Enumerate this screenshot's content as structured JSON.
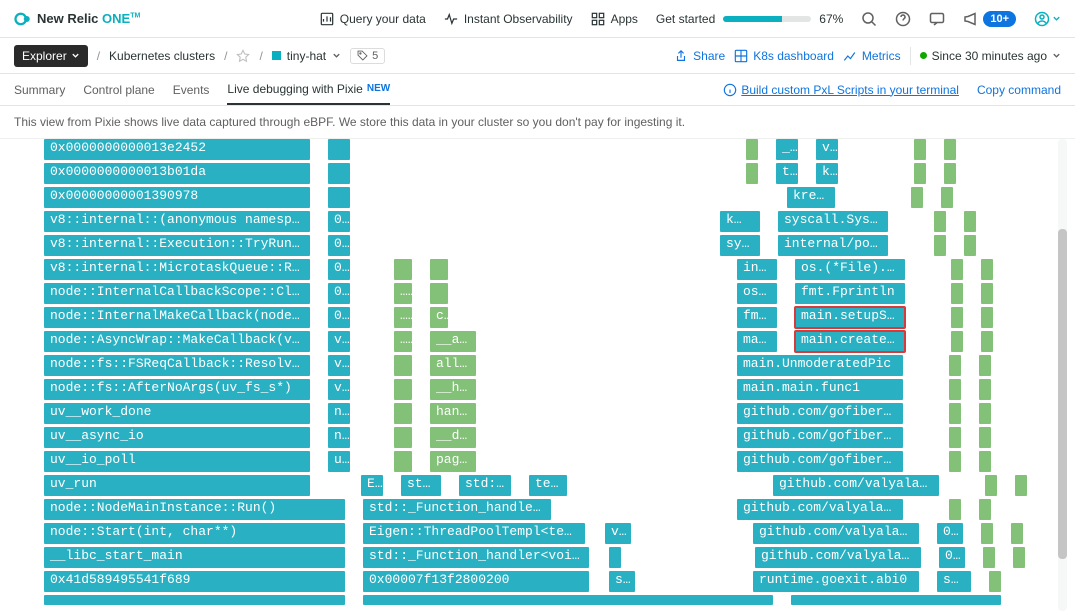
{
  "logo": {
    "text1": "New Relic",
    "text2": "ONE",
    "tm": "TM"
  },
  "topbar": {
    "query": "Query your data",
    "observ": "Instant Observability",
    "apps": "Apps",
    "started": "Get started",
    "percent": "67%",
    "badge": "10+"
  },
  "progress": {
    "value": 67
  },
  "crumbs": {
    "explorer": "Explorer",
    "k8s": "Kubernetes clusters",
    "hat": "tiny-hat",
    "tag_count": "5",
    "share": "Share",
    "k8s_dash": "K8s dashboard",
    "metrics": "Metrics",
    "since": "Since 30 minutes ago"
  },
  "tabs": {
    "summary": "Summary",
    "control": "Control plane",
    "events": "Events",
    "live": "Live debugging with Pixie",
    "new": "NEW",
    "build": "Build custom PxL Scripts in your terminal",
    "copy": "Copy command"
  },
  "descr": "This view from Pixie shows live data captured through eBPF. We store this data in your cluster so you don't pay for ingesting it.",
  "flamegraph": {
    "col1": [
      "0x0000000000013e2452",
      "0x0000000000013b01da",
      "0x00000000001390978",
      "v8::internal::(anonymous namespa…",
      "v8::internal::Execution::TryRunM…",
      "v8::internal::MicrotaskQueue::Ru…",
      "node::InternalCallbackScope::Clo…",
      "node::InternalMakeCallback(node:…",
      "node::AsyncWrap::MakeCallback(v8…",
      "node::fs::FSReqCallback::Resolve…",
      "node::fs::AfterNoArgs(uv_fs_s*)",
      "uv__work_done",
      "uv__async_io",
      "uv__io_poll",
      "uv_run",
      "node::NodeMainInstance::Run()",
      "node::Start(int, char**)",
      "__libc_start_main",
      "0x41d589495541f689"
    ],
    "col2_short": [
      "0…",
      "0…",
      "0…",
      "0…",
      "0…",
      "v…",
      "v…",
      "v…",
      "n…",
      "n…",
      "u…"
    ],
    "col3_mid": [
      "…",
      "…",
      "c…",
      "…",
      "__ag…",
      "allo…",
      "__ha…",
      "hand…",
      "__do…",
      "page…"
    ],
    "col3b": [
      "std…",
      "std::…",
      "ten…"
    ],
    "row15e": "E…",
    "row16": "std::_Function_handler<v…",
    "row17": "Eigen::ThreadPoolTempl<tenso…",
    "row17b": "v8…",
    "row18": "std::_Function_handler<void …",
    "row19": "0x00007f13f2800200",
    "row19b": "st…",
    "rcol": [
      [
        "_…",
        "v…"
      ],
      [
        "t…",
        "k…"
      ],
      [
        "kretp…"
      ],
      [
        "k…",
        "syscall.Sys…"
      ],
      [
        "sys…",
        "internal/pol…"
      ],
      [
        "int…",
        "os.(*File).W…"
      ],
      [
        "os.…",
        "fmt.Fprintln"
      ],
      [
        "fmt.…",
        "main.setupSQL…"
      ],
      [
        "main…",
        "main.createSa…"
      ],
      [
        "main.UnmoderatedPic"
      ],
      [
        "main.main.func1"
      ],
      [
        "github.com/gofiber/fi…"
      ],
      [
        "github.com/gofiber/fi…"
      ],
      [
        "github.com/gofiber/fi…"
      ],
      [
        "github.com/valyala/fa…"
      ],
      [
        "github.com/valyala/fa…"
      ],
      [
        "github.com/valyala/fa…",
        "0x…"
      ],
      [
        "github.com/valyala/fa…",
        "0x…"
      ],
      [
        "runtime.goexit.abi0",
        "sta…"
      ]
    ]
  }
}
